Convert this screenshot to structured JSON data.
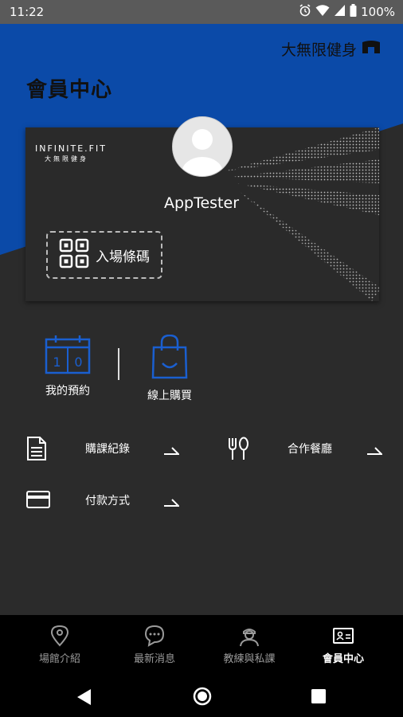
{
  "status_bar": {
    "time": "11:22",
    "battery": "100%"
  },
  "header": {
    "brand": "大無限健身",
    "title": "會員中心"
  },
  "card": {
    "logo": "INFINITE.FIT",
    "logo_sub": "大無限健身",
    "username": "AppTester",
    "barcode_label": "入場條碼"
  },
  "quick_actions": [
    {
      "label": "我的預約",
      "calendar_digits": [
        "1",
        "0"
      ]
    },
    {
      "label": "線上購買"
    }
  ],
  "menu": [
    {
      "label": "購課紀錄",
      "icon": "document-icon"
    },
    {
      "label": "合作餐廳",
      "icon": "fork-spoon-icon"
    },
    {
      "label": "付款方式",
      "icon": "credit-card-icon"
    }
  ],
  "bottom_nav": [
    {
      "label": "場館介紹",
      "icon": "location-pin-icon",
      "active": false
    },
    {
      "label": "最新消息",
      "icon": "chat-bubble-icon",
      "active": false
    },
    {
      "label": "教練與私課",
      "icon": "coach-icon",
      "active": false
    },
    {
      "label": "會員中心",
      "icon": "member-card-icon",
      "active": true
    }
  ],
  "colors": {
    "brand_blue": "#0b4aa8",
    "background": "#2b2b2b",
    "nav_bg": "#000000"
  }
}
